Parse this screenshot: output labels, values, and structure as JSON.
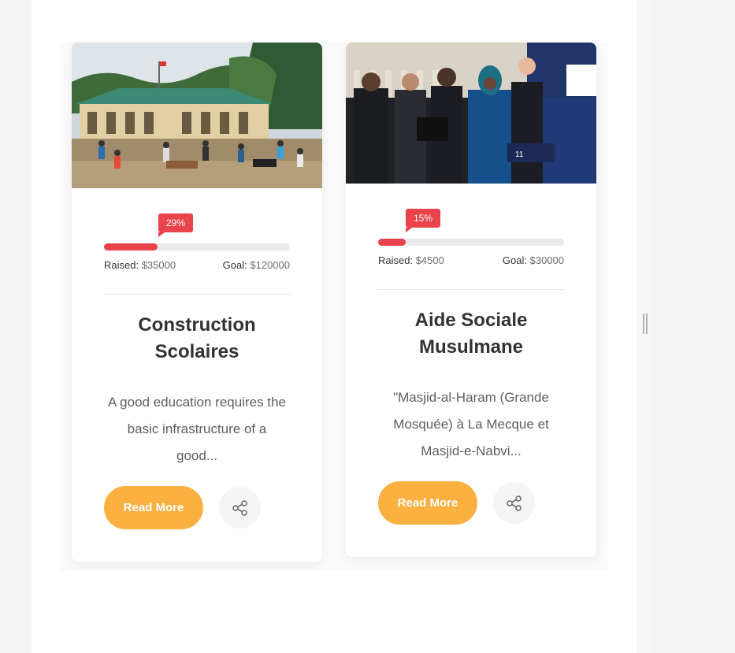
{
  "cards": [
    {
      "percent_label": "29%",
      "percent": 29,
      "raised_label": "Raised:",
      "raised_value": "$35000",
      "goal_label": "Goal:",
      "goal_value": "$120000",
      "title": "Construction Scolaires",
      "description": "A good education requires the basic infrastructure of a good...",
      "read_more": "Read More",
      "share_icon": "share-icon"
    },
    {
      "percent_label": "15%",
      "percent": 15,
      "raised_label": "Raised:",
      "raised_value": "$4500",
      "goal_label": "Goal:",
      "goal_value": "$30000",
      "title": "Aide Sociale Musulmane",
      "description": "\"Masjid-al-Haram (Grande Mosquée) à La Mecque et Masjid-e-Nabvi...",
      "read_more": "Read More",
      "share_icon": "share-icon"
    }
  ],
  "colors": {
    "accent_red": "#e9434b",
    "button_orange": "#fbb040",
    "track_grey": "#eaeaea"
  },
  "icons": {
    "next": "double-bar-arrow-icon"
  }
}
